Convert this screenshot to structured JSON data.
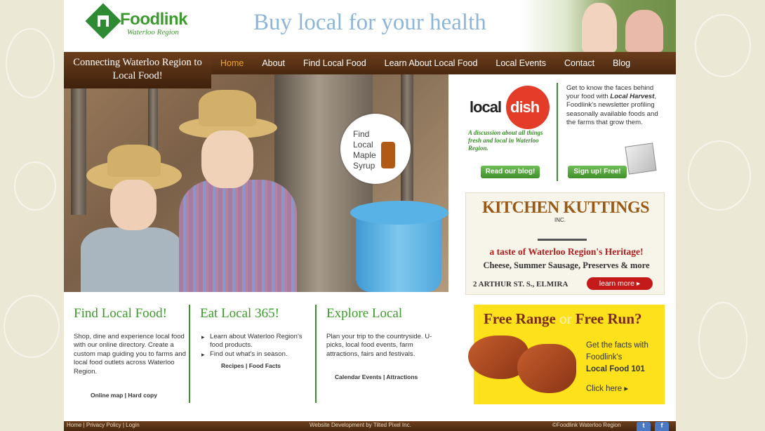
{
  "header": {
    "logo_name": "Foodlink",
    "logo_sub": "Waterloo Region",
    "tagline": "Buy local for your health"
  },
  "banner": {
    "connecting": "Connecting Waterloo Region to Local Food!"
  },
  "nav": {
    "items": [
      {
        "label": "Home",
        "active": true
      },
      {
        "label": "About",
        "active": false
      },
      {
        "label": "Find Local Food",
        "active": false
      },
      {
        "label": "Learn About Local Food",
        "active": false
      },
      {
        "label": "Local Events",
        "active": false
      },
      {
        "label": "Contact",
        "active": false
      },
      {
        "label": "Blog",
        "active": false
      }
    ]
  },
  "hero": {
    "badge_text": "Find Local Maple Syrup"
  },
  "localdish": {
    "logo_local": "local",
    "logo_dish": "dish",
    "description": "A discussion about all things fresh and local in Waterloo Region.",
    "blog_button": "Read our blog!",
    "info_pre": "Get to know the faces behind your food with ",
    "info_emph": "Local Harvest",
    "info_post": ", Foodlink's newsletter profiling seasonally available foods and the farms that grow them.",
    "signup_button": "Sign up! Free!"
  },
  "kitchen": {
    "title": "KITCHEN KUTTINGS",
    "inc": "INC.",
    "tagline": "a taste of Waterloo Region's Heritage!",
    "products": "Cheese, Summer Sausage, Preserves & more",
    "address": "2 ARTHUR ST. S., ELMIRA",
    "learn_more": "learn more ▸"
  },
  "freerange": {
    "title_a": "Free Range",
    "title_or": "or",
    "title_b": "Free Run?",
    "text_pre": "Get the facts with Foodlink's",
    "text_bold": "Local Food 101",
    "click_here": "Click here ▸"
  },
  "columns": [
    {
      "title": "Find Local Food!",
      "text": "Shop, dine and experience local food with our online directory. Create a custom map guiding you to farms and local food outlets across Waterloo Region.",
      "links": "Online map | Hard copy"
    },
    {
      "title": "Eat Local 365!",
      "bullets": [
        "Learn about Waterloo Region's food products.",
        "Find out what's in season."
      ],
      "links": "Recipes | Food Facts"
    },
    {
      "title": "Explore Local",
      "text": "Plan your trip to the countryside. U-picks, local food events, farm attractions, fairs and festivals.",
      "links": "Calendar Events | Attractions"
    }
  ],
  "footer": {
    "left": "Home | Privacy Policy | Login",
    "middle": "Website Development by Tilted Pixel Inc.",
    "right": "©Foodlink Waterloo Region"
  },
  "colors": {
    "brand_green": "#3e9a2c",
    "nav_brown": "#5a3217",
    "nav_active": "#f3a51d",
    "tagline_blue": "#8cb6d9"
  }
}
